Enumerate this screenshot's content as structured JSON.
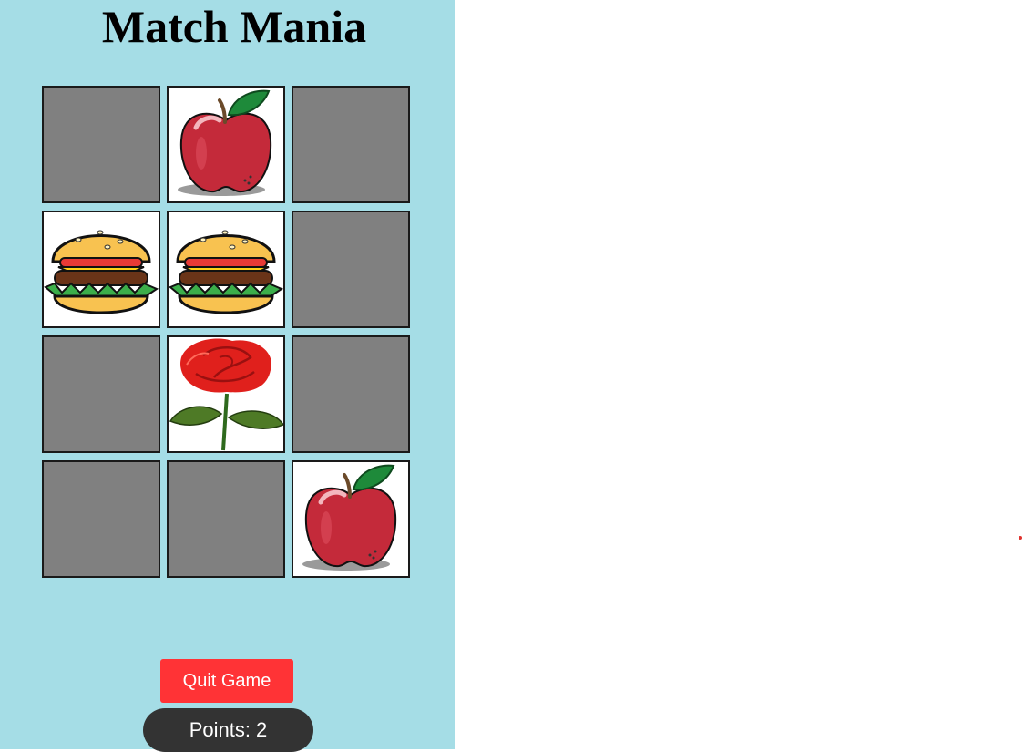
{
  "game": {
    "title": "Match Mania",
    "quit_label": "Quit Game",
    "points_label": "Points: 2",
    "points": 2
  },
  "board": {
    "columns": 3,
    "rows": 4,
    "cards": [
      {
        "state": "hidden",
        "icon": ""
      },
      {
        "state": "revealed",
        "icon": "apple-icon"
      },
      {
        "state": "hidden",
        "icon": ""
      },
      {
        "state": "revealed",
        "icon": "burger-icon"
      },
      {
        "state": "revealed",
        "icon": "burger-icon"
      },
      {
        "state": "hidden",
        "icon": ""
      },
      {
        "state": "hidden",
        "icon": ""
      },
      {
        "state": "revealed",
        "icon": "rose-icon"
      },
      {
        "state": "hidden",
        "icon": ""
      },
      {
        "state": "hidden",
        "icon": ""
      },
      {
        "state": "hidden",
        "icon": ""
      },
      {
        "state": "revealed",
        "icon": "apple-icon"
      }
    ]
  },
  "colors": {
    "panel_background": "#a5dde6",
    "card_back": "#808080",
    "quit_button": "#ff3336",
    "points_badge": "#333333"
  }
}
